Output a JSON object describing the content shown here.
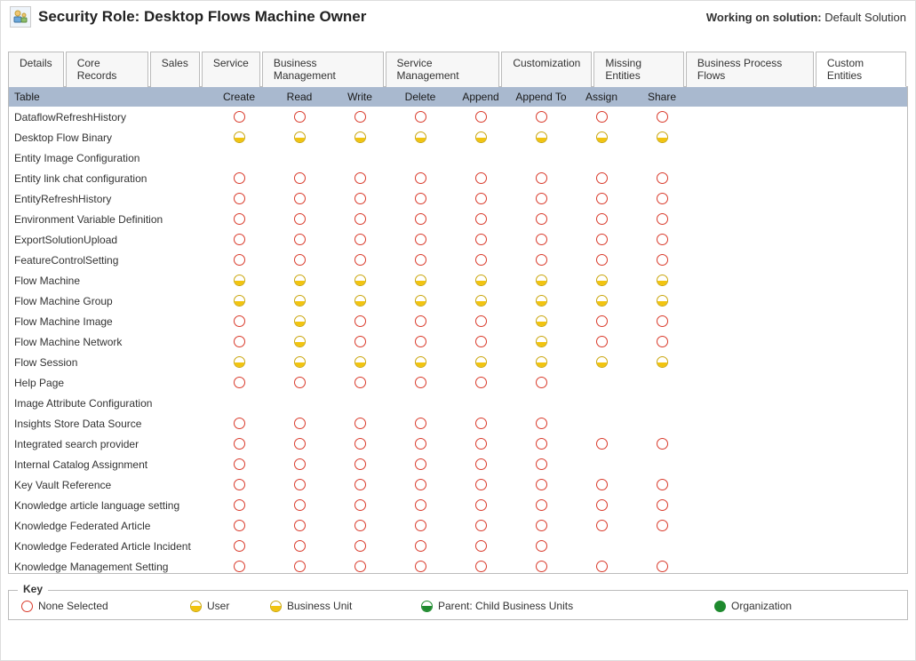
{
  "header": {
    "title": "Security Role: Desktop Flows Machine Owner",
    "working_on_label": "Working on solution:",
    "working_on_value": "Default Solution"
  },
  "tabs": [
    {
      "label": "Details",
      "active": false
    },
    {
      "label": "Core Records",
      "active": false
    },
    {
      "label": "Sales",
      "active": false
    },
    {
      "label": "Service",
      "active": false
    },
    {
      "label": "Business Management",
      "active": false
    },
    {
      "label": "Service Management",
      "active": false
    },
    {
      "label": "Customization",
      "active": false
    },
    {
      "label": "Missing Entities",
      "active": false
    },
    {
      "label": "Business Process Flows",
      "active": false
    },
    {
      "label": "Custom Entities",
      "active": true
    }
  ],
  "columns": {
    "name": "Table",
    "privileges": [
      "Create",
      "Read",
      "Write",
      "Delete",
      "Append",
      "Append To",
      "Assign",
      "Share"
    ]
  },
  "privilege_levels": {
    "none": "None Selected",
    "user": "User",
    "bu": "Business Unit",
    "parent": "Parent: Child Business Units",
    "org": "Organization"
  },
  "rows": [
    {
      "name": "DataflowRefreshHistory",
      "priv": [
        "none",
        "none",
        "none",
        "none",
        "none",
        "none",
        "none",
        "none"
      ]
    },
    {
      "name": "Desktop Flow Binary",
      "priv": [
        "user",
        "user",
        "user",
        "user",
        "user",
        "user",
        "user",
        "user"
      ]
    },
    {
      "name": "Entity Image Configuration",
      "priv": [
        null,
        null,
        null,
        null,
        null,
        null,
        null,
        null
      ]
    },
    {
      "name": "Entity link chat configuration",
      "priv": [
        "none",
        "none",
        "none",
        "none",
        "none",
        "none",
        "none",
        "none"
      ]
    },
    {
      "name": "EntityRefreshHistory",
      "priv": [
        "none",
        "none",
        "none",
        "none",
        "none",
        "none",
        "none",
        "none"
      ]
    },
    {
      "name": "Environment Variable Definition",
      "priv": [
        "none",
        "none",
        "none",
        "none",
        "none",
        "none",
        "none",
        "none"
      ]
    },
    {
      "name": "ExportSolutionUpload",
      "priv": [
        "none",
        "none",
        "none",
        "none",
        "none",
        "none",
        "none",
        "none"
      ]
    },
    {
      "name": "FeatureControlSetting",
      "priv": [
        "none",
        "none",
        "none",
        "none",
        "none",
        "none",
        "none",
        "none"
      ]
    },
    {
      "name": "Flow Machine",
      "priv": [
        "user",
        "user",
        "user",
        "user",
        "user",
        "user",
        "user",
        "user"
      ]
    },
    {
      "name": "Flow Machine Group",
      "priv": [
        "user",
        "user",
        "user",
        "user",
        "user",
        "user",
        "user",
        "user"
      ]
    },
    {
      "name": "Flow Machine Image",
      "priv": [
        "none",
        "user",
        "none",
        "none",
        "none",
        "user",
        "none",
        "none"
      ]
    },
    {
      "name": "Flow Machine Network",
      "priv": [
        "none",
        "user",
        "none",
        "none",
        "none",
        "user",
        "none",
        "none"
      ]
    },
    {
      "name": "Flow Session",
      "priv": [
        "user",
        "user",
        "user",
        "user",
        "user",
        "user",
        "user",
        "user"
      ]
    },
    {
      "name": "Help Page",
      "priv": [
        "none",
        "none",
        "none",
        "none",
        "none",
        "none",
        null,
        null
      ]
    },
    {
      "name": "Image Attribute Configuration",
      "priv": [
        null,
        null,
        null,
        null,
        null,
        null,
        null,
        null
      ]
    },
    {
      "name": "Insights Store Data Source",
      "priv": [
        "none",
        "none",
        "none",
        "none",
        "none",
        "none",
        null,
        null
      ]
    },
    {
      "name": "Integrated search provider",
      "priv": [
        "none",
        "none",
        "none",
        "none",
        "none",
        "none",
        "none",
        "none"
      ]
    },
    {
      "name": "Internal Catalog Assignment",
      "priv": [
        "none",
        "none",
        "none",
        "none",
        "none",
        "none",
        null,
        null
      ]
    },
    {
      "name": "Key Vault Reference",
      "priv": [
        "none",
        "none",
        "none",
        "none",
        "none",
        "none",
        "none",
        "none"
      ]
    },
    {
      "name": "Knowledge article language setting",
      "priv": [
        "none",
        "none",
        "none",
        "none",
        "none",
        "none",
        "none",
        "none"
      ]
    },
    {
      "name": "Knowledge Federated Article",
      "priv": [
        "none",
        "none",
        "none",
        "none",
        "none",
        "none",
        "none",
        "none"
      ]
    },
    {
      "name": "Knowledge Federated Article Incident",
      "priv": [
        "none",
        "none",
        "none",
        "none",
        "none",
        "none",
        null,
        null
      ]
    },
    {
      "name": "Knowledge Management Setting",
      "priv": [
        "none",
        "none",
        "none",
        "none",
        "none",
        "none",
        "none",
        "none"
      ]
    }
  ],
  "legend": {
    "title": "Key",
    "items": [
      "none",
      "user",
      "bu",
      "parent",
      "org"
    ]
  }
}
